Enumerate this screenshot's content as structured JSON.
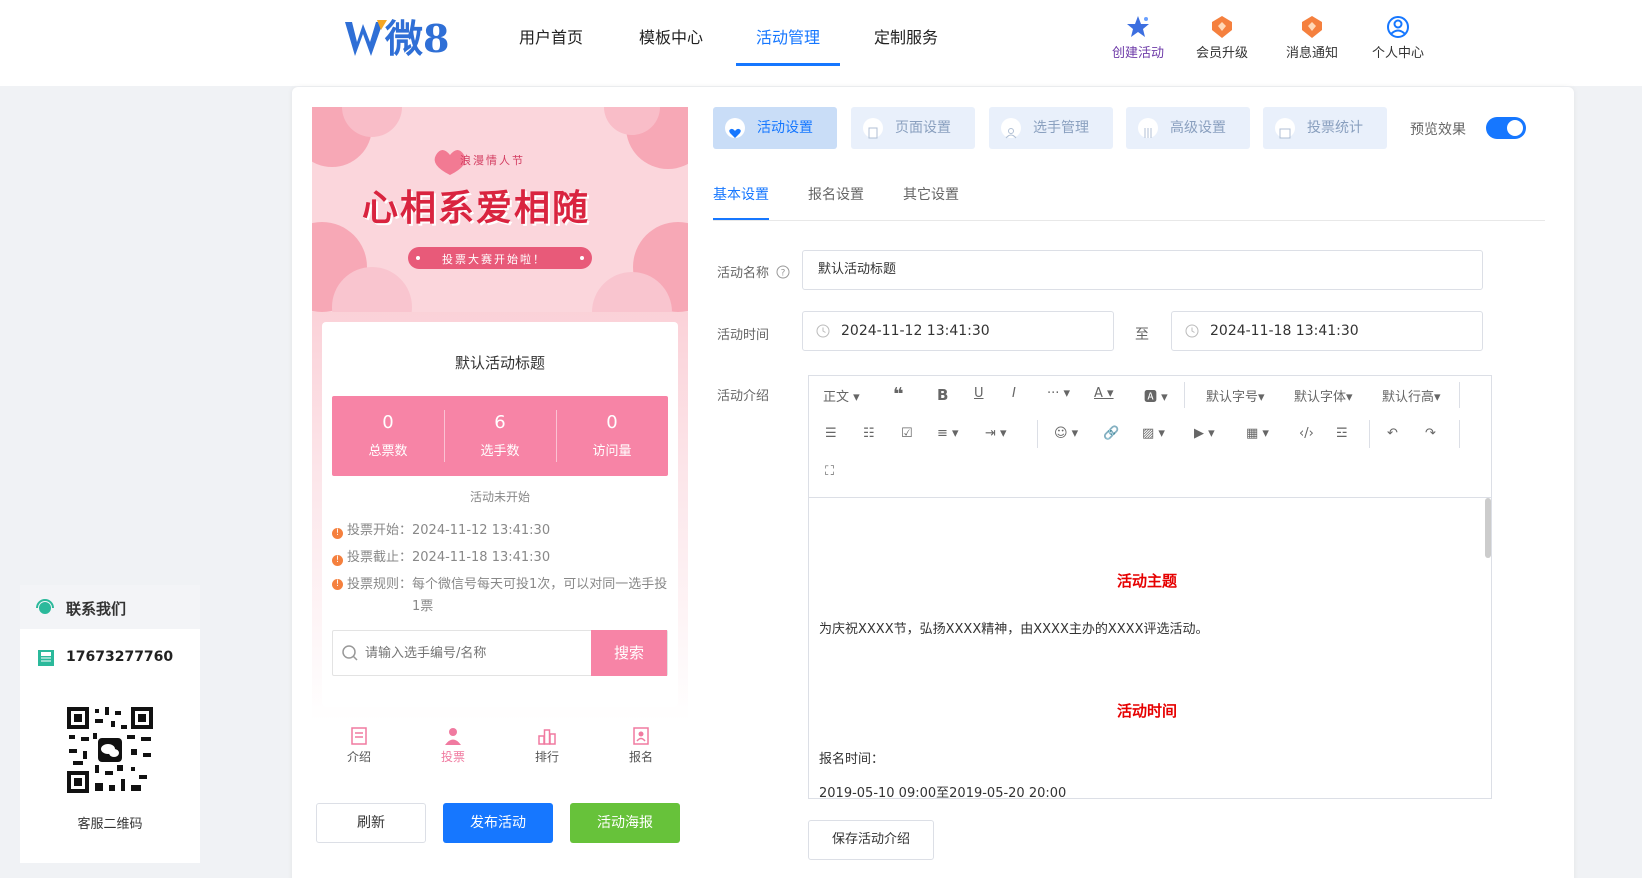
{
  "header": {
    "logo_text": "微8",
    "nav": [
      "用户首页",
      "模板中心",
      "活动管理",
      "定制服务"
    ],
    "active_nav": "活动管理",
    "icons": [
      {
        "label": "创建活动",
        "icon": "star-icon"
      },
      {
        "label": "会员升级",
        "icon": "vip-badge-icon"
      },
      {
        "label": "消息通知",
        "icon": "vip-badge-icon"
      },
      {
        "label": "个人中心",
        "icon": "user-circle-icon"
      }
    ]
  },
  "preview": {
    "banner": {
      "line1": "浪漫情人节",
      "line2": "心相系爱相随",
      "line3": "投票大赛开始啦！"
    },
    "title": "默认活动标题",
    "stats": [
      {
        "value": "0",
        "label": "总票数"
      },
      {
        "value": "6",
        "label": "选手数"
      },
      {
        "value": "0",
        "label": "访问量"
      }
    ],
    "status": "活动未开始",
    "rules": [
      {
        "label": "投票开始：",
        "value": "2024-11-12 13:41:30"
      },
      {
        "label": "投票截止：",
        "value": "2024-11-18 13:41:30"
      },
      {
        "label": "投票规则：",
        "value": "每个微信号每天可投1次，可以对同一选手投1票"
      }
    ],
    "search_placeholder": "请输入选手编号/名称",
    "search_button": "搜索",
    "tabbar": [
      "介绍",
      "投票",
      "排行",
      "报名"
    ],
    "active_tab": "投票"
  },
  "preview_buttons": {
    "refresh": "刷新",
    "publish": "发布活动",
    "poster": "活动海报"
  },
  "settings_tabs": [
    "活动设置",
    "页面设置",
    "选手管理",
    "高级设置",
    "投票统计"
  ],
  "active_settings_tab": "活动设置",
  "preview_toggle": {
    "label": "预览效果",
    "on": true
  },
  "sub_tabs": [
    "基本设置",
    "报名设置",
    "其它设置"
  ],
  "active_sub_tab": "基本设置",
  "form": {
    "name_label": "活动名称",
    "name_value": "默认活动标题",
    "time_label": "活动时间",
    "start_time": "2024-11-12 13:41:30",
    "to": "至",
    "end_time": "2024-11-18 13:41:30",
    "intro_label": "活动介绍"
  },
  "editor": {
    "toolbar": {
      "paragraph": "正文",
      "font_size": "默认字号",
      "font_family": "默认字体",
      "line_height": "默认行高"
    },
    "content": {
      "heading1": "活动主题",
      "para1": "为庆祝XXXX节，弘扬XXXX精神，由XXXX主办的XXXX评选活动。",
      "heading2": "活动时间",
      "para2": "报名时间：",
      "para3": "2019-05-10 09:00至2019-05-20 20:00"
    }
  },
  "save_intro_button": "保存活动介绍",
  "contact": {
    "title": "联系我们",
    "phone": "17673277760",
    "qr_label": "客服二维码"
  },
  "colors": {
    "primary": "#1677ff",
    "pink": "#f784a6",
    "green": "#67c23a",
    "red": "#e60000"
  }
}
